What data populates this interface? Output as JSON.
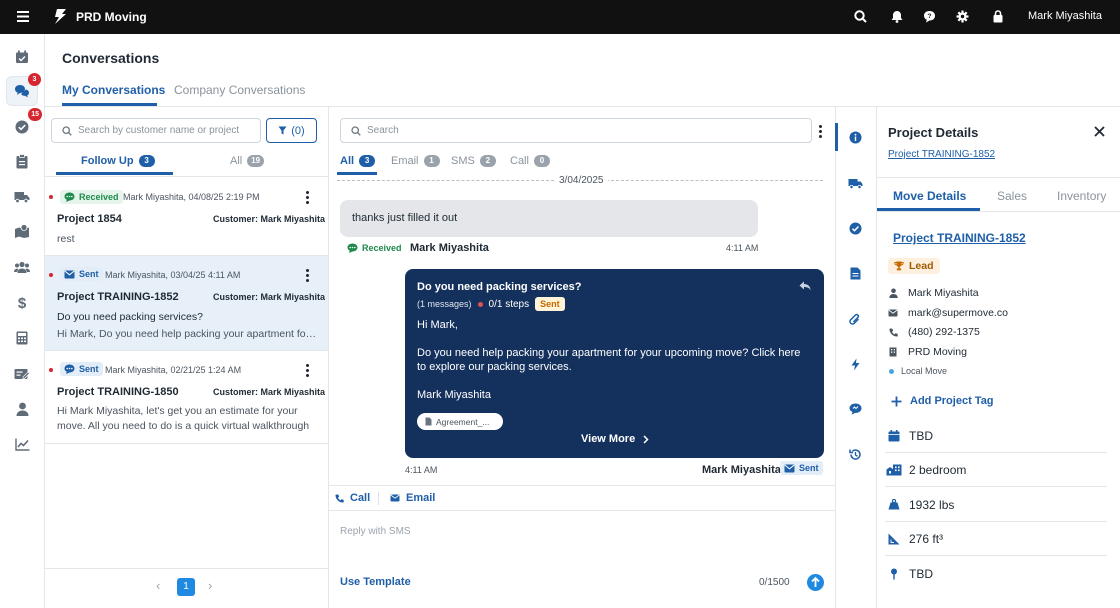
{
  "app": {
    "name": "PRD Moving",
    "user": "Mark Miyashita"
  },
  "rail": {
    "conversations_badge": "3",
    "tasks_badge": "15"
  },
  "page": {
    "title": "Conversations",
    "tabs": {
      "mine": "My Conversations",
      "company": "Company Conversations"
    }
  },
  "list": {
    "search_placeholder": "Search by customer name or project",
    "filter_label": "(0)",
    "tabs": [
      {
        "label": "Follow Up",
        "count": "3"
      },
      {
        "label": "All",
        "count": "19"
      }
    ],
    "items": [
      {
        "status": "Received",
        "meta": "Mark Miyashita, 04/08/25 2:19 PM",
        "title": "Project 1854",
        "customer": "Customer: Mark Miyashita",
        "preview": "rest"
      },
      {
        "status": "Sent",
        "meta": "Mark Miyashita, 03/04/25 4:11 AM",
        "title": "Project TRAINING-1852",
        "customer": "Customer: Mark Miyashita",
        "subject": "Do you need packing services?",
        "preview": "Hi Mark, Do you need help packing your apartment for your upcoming move?"
      },
      {
        "status": "Sent",
        "meta": "Mark Miyashita, 02/21/25 1:24 AM",
        "title": "Project TRAINING-1850",
        "customer": "Customer: Mark Miyashita",
        "preview": "Hi Mark Miyashita, let's get you an estimate for your move. All you need to do is a quick virtual walkthrough of your home."
      }
    ],
    "page_number": "1"
  },
  "chat": {
    "search_placeholder": "Search",
    "tabs": [
      {
        "label": "All",
        "count": "3"
      },
      {
        "label": "Email",
        "count": "1"
      },
      {
        "label": "SMS",
        "count": "2"
      },
      {
        "label": "Call",
        "count": "0"
      }
    ],
    "date": "3/04/2025",
    "incoming": {
      "text": "thanks just filled it out",
      "status": "Received",
      "author": "Mark Miyashita",
      "time": "4:11 AM"
    },
    "outgoing": {
      "title": "Do you need packing services?",
      "messages": "(1 messages)",
      "steps": "0/1 steps",
      "chip": "Sent",
      "greeting": "Hi Mark,",
      "body": "Do you need help packing your apartment for your upcoming move? Click here to explore our packing services.",
      "signature": "Mark Miyashita",
      "attachment": "Agreement_...",
      "view_more": "View More",
      "time": "4:11 AM",
      "author": "Mark Miyashita",
      "status": "Sent"
    },
    "actions": {
      "call": "Call",
      "email": "Email"
    },
    "reply_placeholder": "Reply with SMS",
    "use_template": "Use Template",
    "counter": "0/1500"
  },
  "details": {
    "title": "Project Details",
    "project_link": "Project TRAINING-1852",
    "tabs": [
      "Move Details",
      "Sales",
      "Inventory"
    ],
    "project_heading": "Project TRAINING-1852",
    "tag": "Lead",
    "contact": {
      "name": "Mark Miyashita",
      "email": "mark@supermove.co",
      "phone": "(480) 292-1375",
      "company": "PRD Moving",
      "move_type": "Local Move"
    },
    "add_tag": "Add Project Tag",
    "rows": [
      {
        "icon": "calendar-icon",
        "value": "TBD"
      },
      {
        "icon": "building-icon",
        "value": "2 bedroom"
      },
      {
        "icon": "weight-icon",
        "value": "1932 lbs"
      },
      {
        "icon": "volume-icon",
        "value": "276 ft³"
      },
      {
        "icon": "location-pin-icon",
        "value": "TBD"
      }
    ]
  },
  "colors": {
    "primary": "#1f5fa8",
    "navy": "#14305c",
    "topbar": "#111111",
    "badge": "#d6262f"
  }
}
